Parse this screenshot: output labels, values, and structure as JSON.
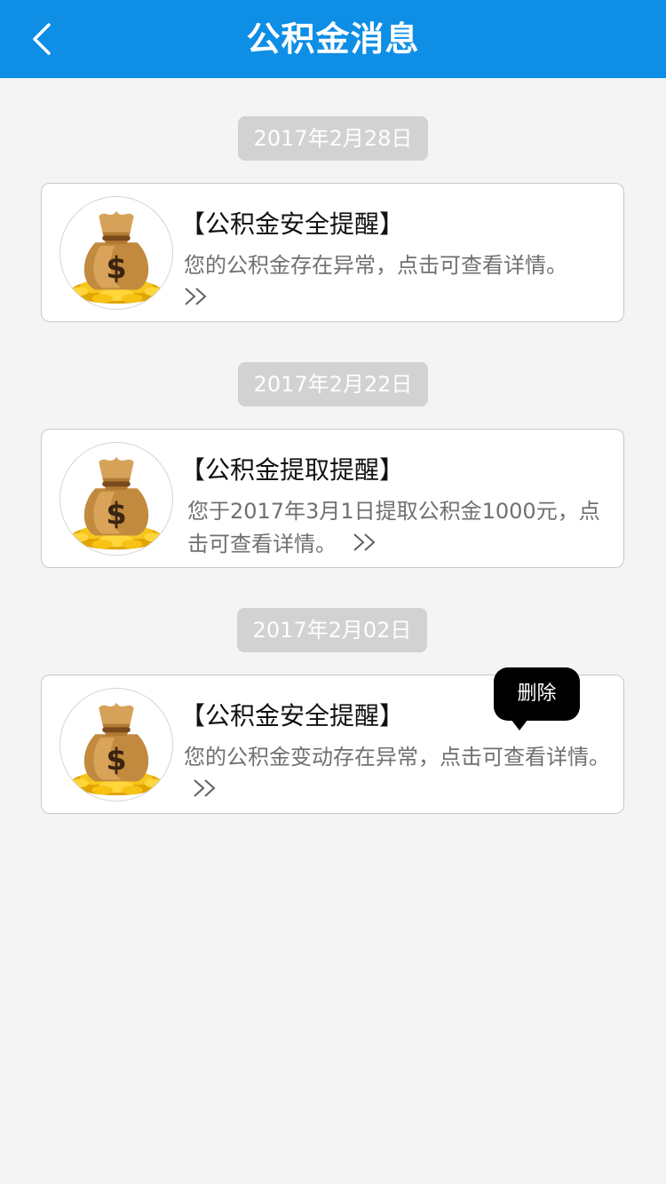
{
  "header": {
    "title": "公积金消息",
    "back_icon": "chevron-left-icon",
    "color": "#0f8ee6"
  },
  "messages": [
    {
      "date": "2017年2月28日",
      "title": "【公积金安全提醒】",
      "desc": "您的公积金存在异常，点击可查看详情。",
      "more_icon": "double-chevron-right-icon",
      "avatar_icon": "money-bag-icon"
    },
    {
      "date": "2017年2月22日",
      "title": "【公积金提取提醒】",
      "desc": "您于2017年3月1日提取公积金1000元，点击可查看详情。",
      "more_icon": "double-chevron-right-icon",
      "avatar_icon": "money-bag-icon"
    },
    {
      "date": "2017年2月02日",
      "title": "【公积金安全提醒】",
      "desc": "您的公积金变动存在异常，点击可查看详情。",
      "more_icon": "double-chevron-right-icon",
      "avatar_icon": "money-bag-icon"
    }
  ],
  "popup": {
    "delete_label": "删除"
  }
}
